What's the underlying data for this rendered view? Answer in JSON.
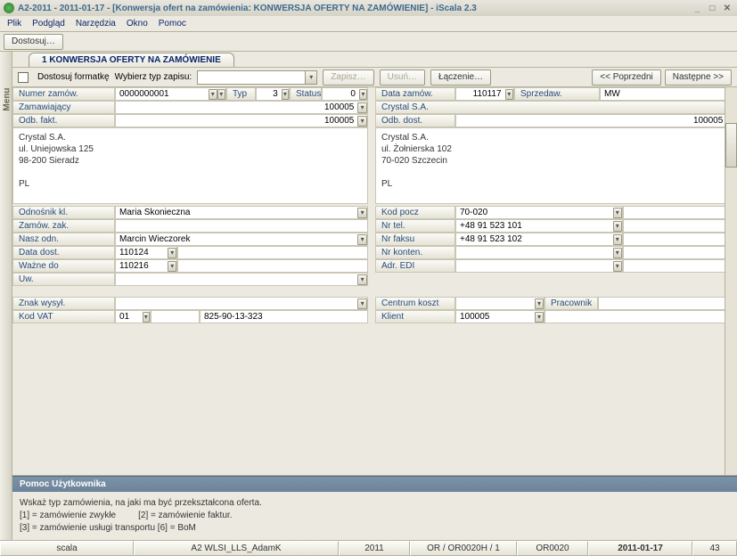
{
  "window": {
    "title": "A2-2011 - 2011-01-17 - [Konwersja ofert na zamówienia: KONWERSJA OFERTY NA ZAMÓWIENIE] - iScala 2.3"
  },
  "menu": [
    "Plik",
    "Podgląd",
    "Narzędzia",
    "Okno",
    "Pomoc"
  ],
  "toolbar": {
    "dostosuj": "Dostosuj…"
  },
  "sidemenu": "Menu",
  "tab": "1 KONWERSJA OFERTY NA ZAMÓWIENIE",
  "formbar": {
    "dostosuj_formatke": "Dostosuj formatkę",
    "wybierz": "Wybierz typ zapisu:",
    "zapisz": "Zapisz…",
    "usun": "Usuń…",
    "laczenie": "Łączenie…",
    "poprzedni": "<< Poprzedni",
    "nastepne": "Następne >>"
  },
  "fields": {
    "numer_zamow_lbl": "Numer zamów.",
    "numer_zamow": "0000000001",
    "typ_lbl": "Typ",
    "typ": "3",
    "status_lbl": "Status",
    "status": "0",
    "data_zamow_lbl": "Data zamów.",
    "data_zamow": "110117",
    "sprzedaw_lbl": "Sprzedaw.",
    "sprzedaw": "MW",
    "zamawiajacy_lbl": "Zamawiający",
    "zamawiajacy": "100005",
    "crystal1": "Crystal S.A.",
    "odb_fakt_lbl": "Odb. fakt.",
    "odb_fakt": "100005",
    "odb_dost_lbl": "Odb. dost.",
    "odb_dost": "100005",
    "addr_left": "Crystal S.A.\nul. Uniejowska 125\n98-200 Sieradz\n\nPL",
    "addr_right": "Crystal S.A.\nul. Żołnierska 102\n70-020 Szczecin\n\nPL",
    "odnosnik_lbl": "Odnośnik kl.",
    "odnosnik": "Maria Skonieczna",
    "zamow_zak_lbl": "Zamów. zak.",
    "zamow_zak": "",
    "nasz_odn_lbl": "Nasz odn.",
    "nasz_odn": "Marcin Wieczorek",
    "data_dost_lbl": "Data dost.",
    "data_dost": "110124",
    "wazne_do_lbl": "Ważne do",
    "wazne_do": "110216",
    "uw_lbl": "Uw.",
    "uw": "",
    "znak_wysyl_lbl": "Znak wysył.",
    "znak_wysyl": "",
    "kod_vat_lbl": "Kod VAT",
    "kod_vat": "01",
    "kod_vat_full": "825-90-13-323",
    "kod_pocz_lbl": "Kod pocz",
    "kod_pocz": "70-020",
    "nr_tel_lbl": "Nr tel.",
    "nr_tel": "+48 91 523 101",
    "nr_faksu_lbl": "Nr faksu",
    "nr_faksu": "+48 91 523 102",
    "nr_konten_lbl": "Nr konten.",
    "nr_konten": "",
    "adr_edi_lbl": "Adr. EDI",
    "adr_edi": "",
    "centrum_lbl": "Centrum koszt",
    "centrum": "",
    "pracownik_lbl": "Pracownik",
    "pracownik": "",
    "klient_lbl": "Klient",
    "klient": "100005"
  },
  "help": {
    "title": "Pomoc Użytkownika",
    "l1": "Wskaż typ zamówienia, na jaki ma być przekształcona oferta.",
    "l2": "[1] = zamówienie zwykłe         [2] = zamówienie faktur.",
    "l3": "[3] = zamówienie usługi transportu [6] = BoM"
  },
  "status": {
    "c1": "scala",
    "c2": "A2 WLSI_LLS_AdamK",
    "c3": "2011",
    "c4": "OR / OR0020H / 1",
    "c5": "OR0020",
    "c6": "2011-01-17",
    "c7": "43"
  }
}
